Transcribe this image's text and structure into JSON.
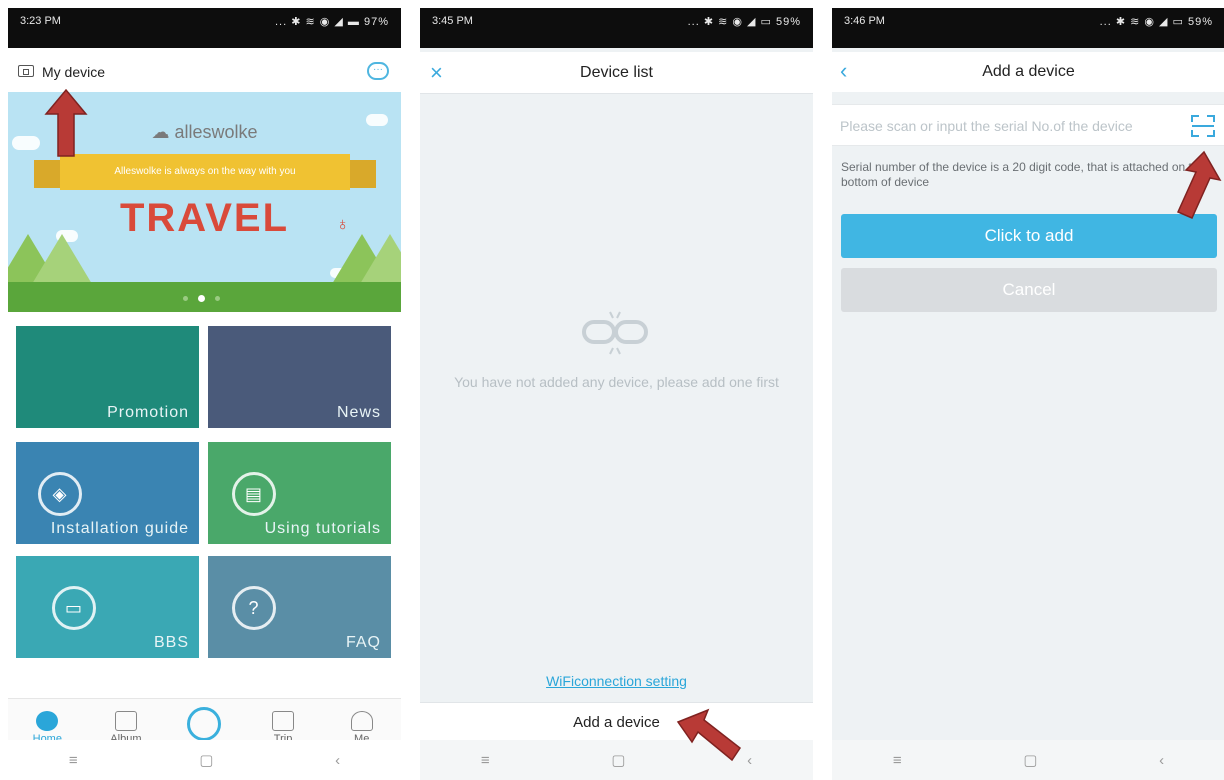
{
  "screens": [
    {
      "status": {
        "time": "3:23 PM",
        "icons": "... ✱ ≋ ◉ ◢ ▬ 97%"
      },
      "topbar": {
        "title": "My device"
      },
      "banner": {
        "brand": "alleswolke",
        "tagline": "Alleswolke is always on the way with you",
        "headline": "TRAVEL",
        "active_dot": 2,
        "dot_count": 3
      },
      "tiles": [
        {
          "label": "Promotion",
          "color": "#1f8a7a"
        },
        {
          "label": "News",
          "color": "#4a5a7a"
        },
        {
          "label": "Installation guide",
          "color": "#3a84b2"
        },
        {
          "label": "Using tutorials",
          "color": "#4aa86a"
        },
        {
          "label": "BBS",
          "color": "#3aa8b4"
        },
        {
          "label": "FAQ",
          "color": "#5a8ea6"
        }
      ],
      "tabs": [
        {
          "label": "Home",
          "icon": "home-icon"
        },
        {
          "label": "Album",
          "icon": "album-icon"
        },
        {
          "label": "",
          "icon": "record-icon"
        },
        {
          "label": "Trip",
          "icon": "trip-icon"
        },
        {
          "label": "Me",
          "icon": "person-icon"
        }
      ]
    },
    {
      "status": {
        "time": "3:45 PM",
        "icons": "... ✱ ≋ ◉ ◢ ▭ 59%"
      },
      "topbar": {
        "title": "Device list"
      },
      "empty_message": "You have not added any device, please add one first",
      "wifi_link": "WiFiconnection setting",
      "add_button": "Add a device"
    },
    {
      "status": {
        "time": "3:46 PM",
        "icons": "... ✱ ≋ ◉ ◢ ▭ 59%"
      },
      "topbar": {
        "title": "Add a device"
      },
      "serial_placeholder": "Please scan or input the serial No.of the device",
      "hint": "Serial number of the device is a 20 digit code, that is attached on the bottom of device",
      "add_button": "Click to add",
      "cancel_button": "Cancel"
    }
  ],
  "navbar": {
    "menu": "≡",
    "home": "▢",
    "back": "‹"
  },
  "colors": {
    "accent": "#40b6e3",
    "arrow": "#b83a36"
  }
}
